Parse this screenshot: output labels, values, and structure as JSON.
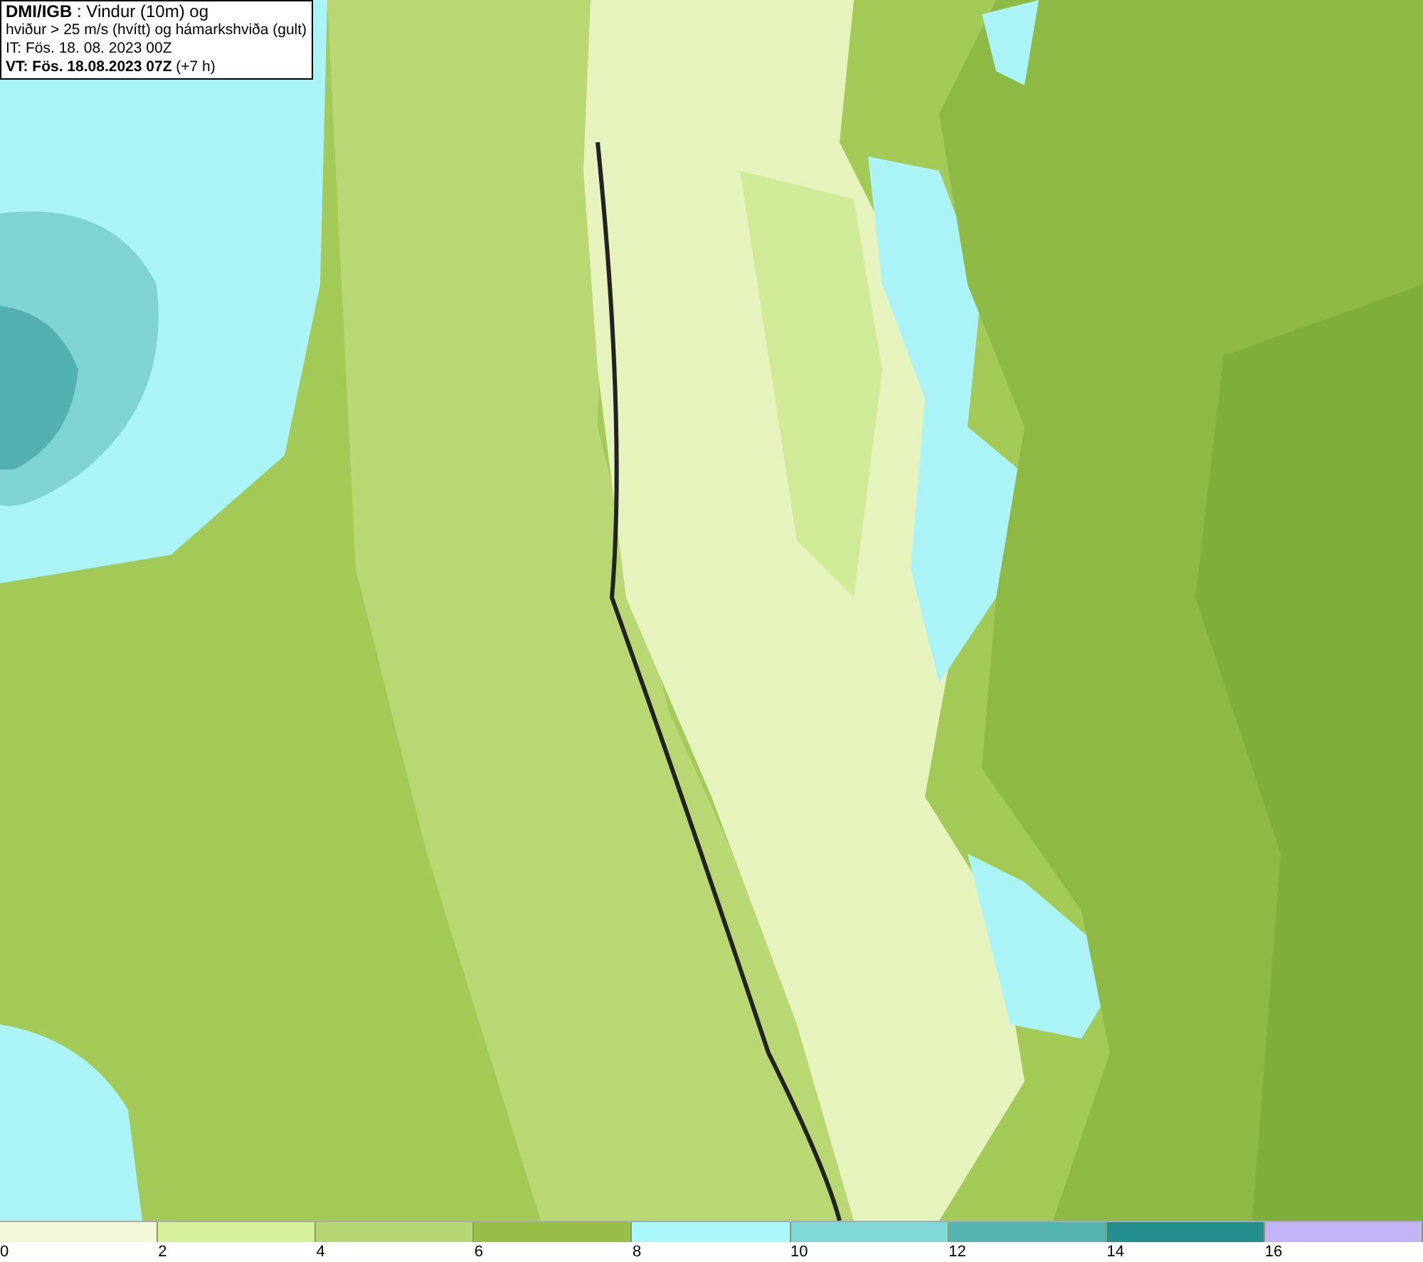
{
  "info_box": {
    "lines": [
      "**DMI/IGB** : Vindur (10m) og",
      "hviður > 25 m/s (hvítt) og hámarkshviða (gult)",
      "IT: Fös. 18. 08. 2023 00Z",
      "**VT: Fös. 18.08.2023 07Z** (+7 h)"
    ]
  },
  "legend": {
    "segments": [
      {
        "color": "#f1f9d9"
      },
      {
        "color": "#d6ef9b"
      },
      {
        "color": "#b6d774"
      },
      {
        "color": "#98be48"
      },
      {
        "color": "#aaf8fb"
      },
      {
        "color": "#80d9d8"
      },
      {
        "color": "#55b3b2"
      },
      {
        "color": "#238e8b"
      },
      {
        "color": "#c2b4f7"
      }
    ],
    "ticks": [
      "0",
      "2",
      "4",
      "6",
      "8",
      "10",
      "12",
      "14",
      "16"
    ]
  }
}
